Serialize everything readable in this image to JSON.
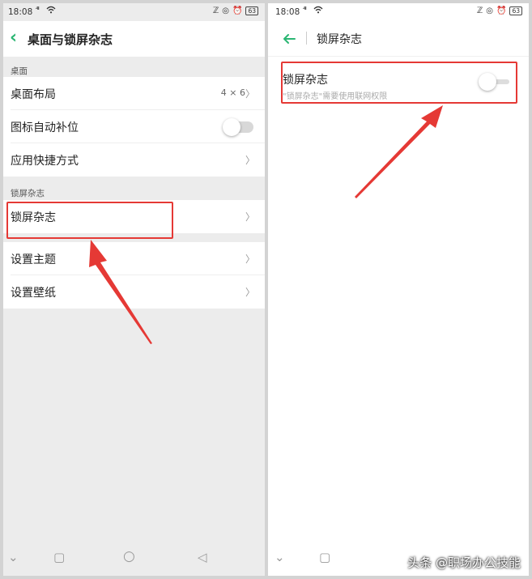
{
  "left": {
    "status": {
      "time": "18:08",
      "signal": "⁴ᵍ",
      "battery": "63"
    },
    "title": "桌面与锁屏杂志",
    "section_desktop": "桌面",
    "rows_desktop": [
      {
        "label": "桌面布局",
        "value": "4 × 6",
        "chevron": "〉"
      },
      {
        "label": "图标自动补位"
      },
      {
        "label": "应用快捷方式",
        "chevron": "〉"
      }
    ],
    "section_lock": "锁屏杂志",
    "row_lock": {
      "label": "锁屏杂志",
      "chevron": "〉"
    },
    "rows_other": [
      {
        "label": "设置主题",
        "chevron": "〉"
      },
      {
        "label": "设置壁纸",
        "chevron": "〉"
      }
    ],
    "toggle_auto_fill": "off"
  },
  "right": {
    "status": {
      "time": "18:08",
      "battery": "63"
    },
    "title": "锁屏杂志",
    "setting": {
      "label": "锁屏杂志",
      "subtitle": "\"锁屏杂志\"需要使用联网权限",
      "toggle": "off"
    }
  },
  "watermark": "头条 @职场办公技能",
  "colors": {
    "accent": "#2bb673",
    "highlight": "#e53935"
  }
}
